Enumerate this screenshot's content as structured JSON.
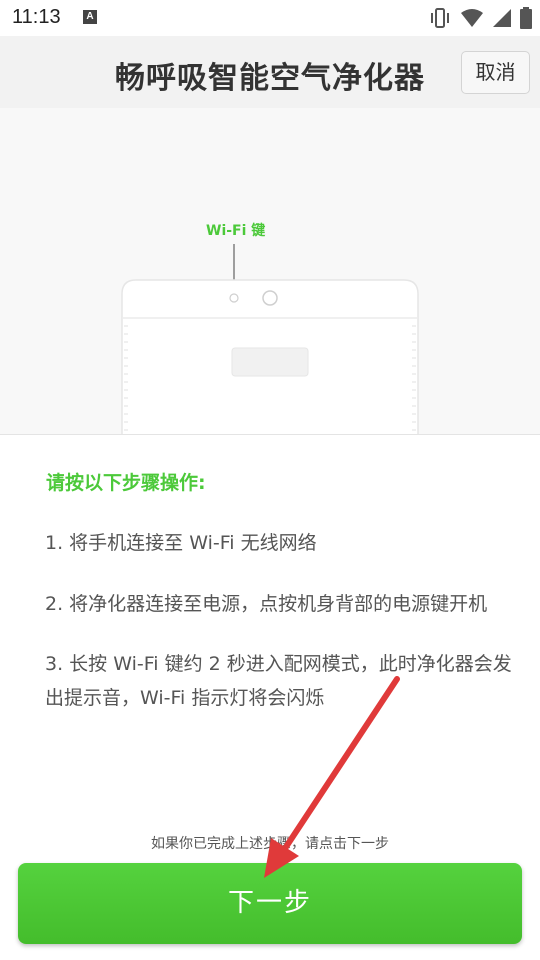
{
  "status_bar": {
    "time": "11:13",
    "notification_icon": "A",
    "icons": [
      "vibrate-icon",
      "wifi-icon",
      "signal-icon",
      "battery-icon"
    ]
  },
  "header": {
    "title": "畅呼吸智能空气净化器",
    "cancel_label": "取消"
  },
  "illustration": {
    "wifi_key_label": "Wi-Fi 键"
  },
  "instructions": {
    "heading": "请按以下步骤操作:",
    "steps": [
      "1. 将手机连接至 Wi-Fi 无线网络",
      "2. 将净化器连接至电源，点按机身背部的电源键开机",
      "3. 长按 Wi-Fi 键约 2 秒进入配网模式，此时净化器会发出提示音，Wi-Fi 指示灯将会闪烁"
    ]
  },
  "hint": "如果你已完成上述步骤，请点击下一步",
  "next_button_label": "下一步",
  "colors": {
    "accent": "#4cc93a",
    "button": "#4ccb35",
    "arrow": "#e03a3a"
  }
}
